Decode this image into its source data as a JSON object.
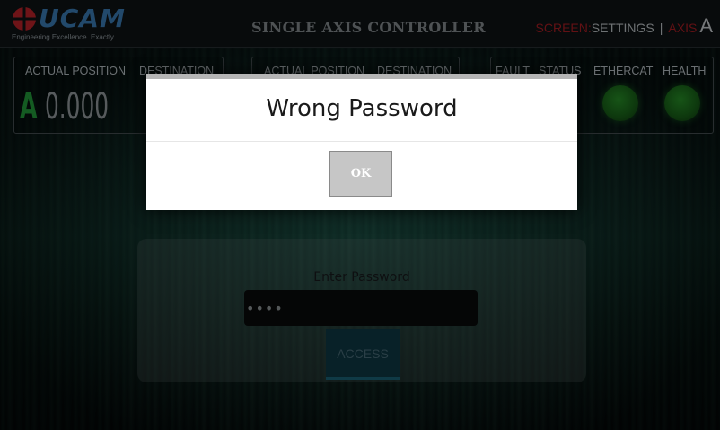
{
  "brand": {
    "name": "UCAM",
    "tagline": "Engineering Excellence. Exactly."
  },
  "header": {
    "title": "SINGLE AXIS CONTROLLER",
    "nav": {
      "screen_label": "SCREEN:",
      "settings_label": "SETTINGS",
      "separator": "|",
      "axis_label": "AXIS",
      "axis_value": "A"
    }
  },
  "panels": {
    "axis_a": {
      "actual_position_label": "ACTUAL POSITION",
      "destination_label": "DESTINATION",
      "axis_letter": "A",
      "position_value": "0.000"
    },
    "axis_b": {
      "actual_position_label": "ACTUAL POSITION",
      "destination_label": "DESTINATION"
    },
    "status": {
      "fault_label": "FAULT",
      "status_label": "STATUS",
      "ethercat_label": "ETHERCAT",
      "health_label": "HEALTH",
      "led_color": "#1f7a1f"
    }
  },
  "login": {
    "prompt": "Enter Password",
    "password_value": "••••",
    "access_label": "ACCESS"
  },
  "dialog": {
    "title": "Wrong Password",
    "ok_label": "OK"
  },
  "colors": {
    "accent_red": "#b32026",
    "brand_blue": "#3f86c4",
    "axis_green": "#26a63f"
  }
}
